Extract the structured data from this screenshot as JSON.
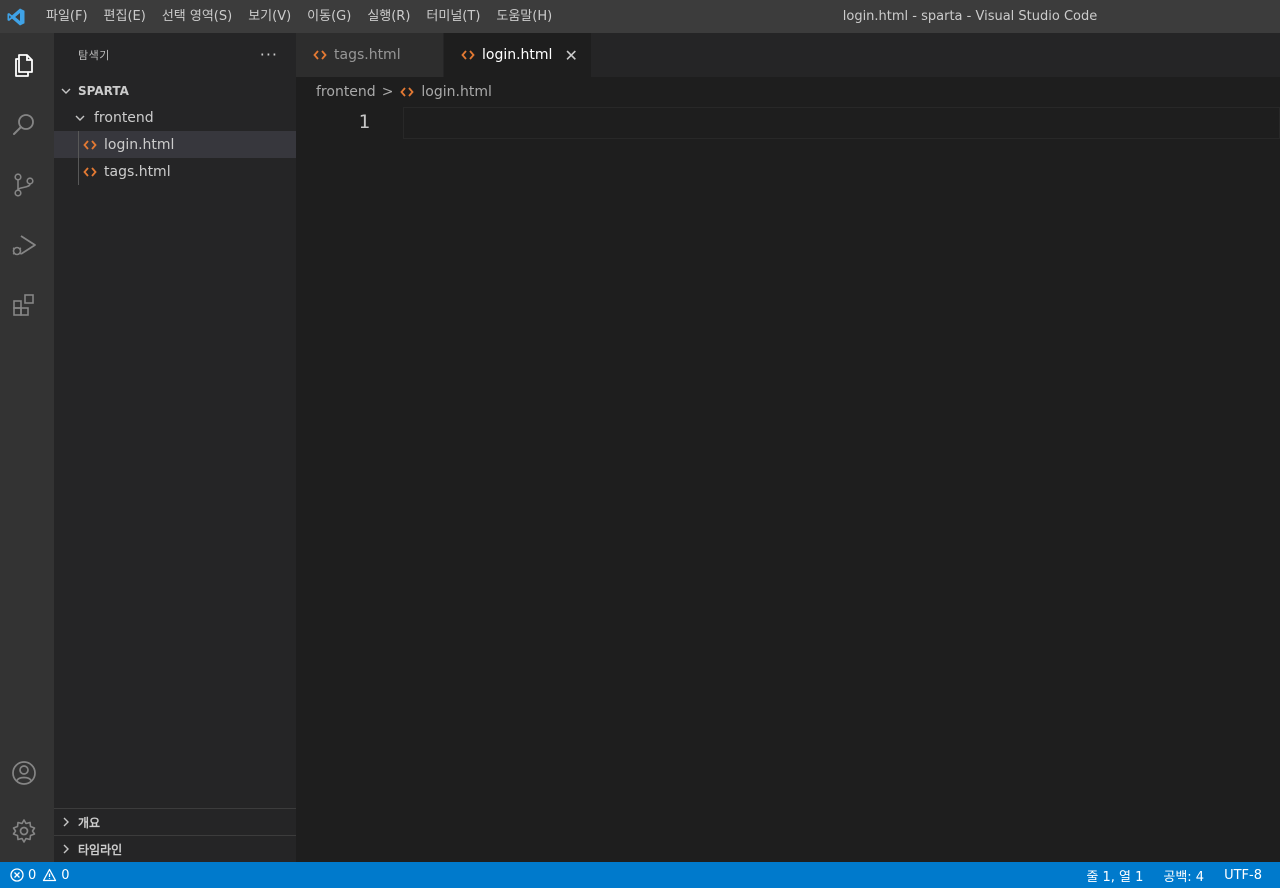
{
  "titlebar": {
    "menu": [
      "파일(F)",
      "편집(E)",
      "선택 영역(S)",
      "보기(V)",
      "이동(G)",
      "실행(R)",
      "터미널(T)",
      "도움말(H)"
    ],
    "window_title": "login.html - sparta - Visual Studio Code"
  },
  "sidebar": {
    "header_title": "탐색기",
    "more_label": "···",
    "workspace": "SPARTA",
    "folder": "frontend",
    "files": [
      "login.html",
      "tags.html"
    ],
    "selected_file": "login.html",
    "outline_label": "개요",
    "timeline_label": "타임라인"
  },
  "editor": {
    "tabs": [
      {
        "label": "tags.html",
        "active": false
      },
      {
        "label": "login.html",
        "active": true
      }
    ],
    "close_glyph": "✕",
    "breadcrumb": {
      "folder": "frontend",
      "separator": ">",
      "file": "login.html"
    },
    "line_numbers": [
      "1"
    ]
  },
  "statusbar": {
    "errors": "0",
    "warnings": "0",
    "position": "줄 1, 열 1",
    "spaces": "공백: 4",
    "encoding": "UTF-8"
  },
  "colors": {
    "accent": "#007acc",
    "html_icon": "#e37933",
    "vscode_logo": "#3fa2e6"
  },
  "icons": {
    "activity": [
      "files-icon",
      "search-icon",
      "source-control-icon",
      "run-debug-icon",
      "extensions-icon",
      "account-icon",
      "settings-gear-icon"
    ]
  }
}
